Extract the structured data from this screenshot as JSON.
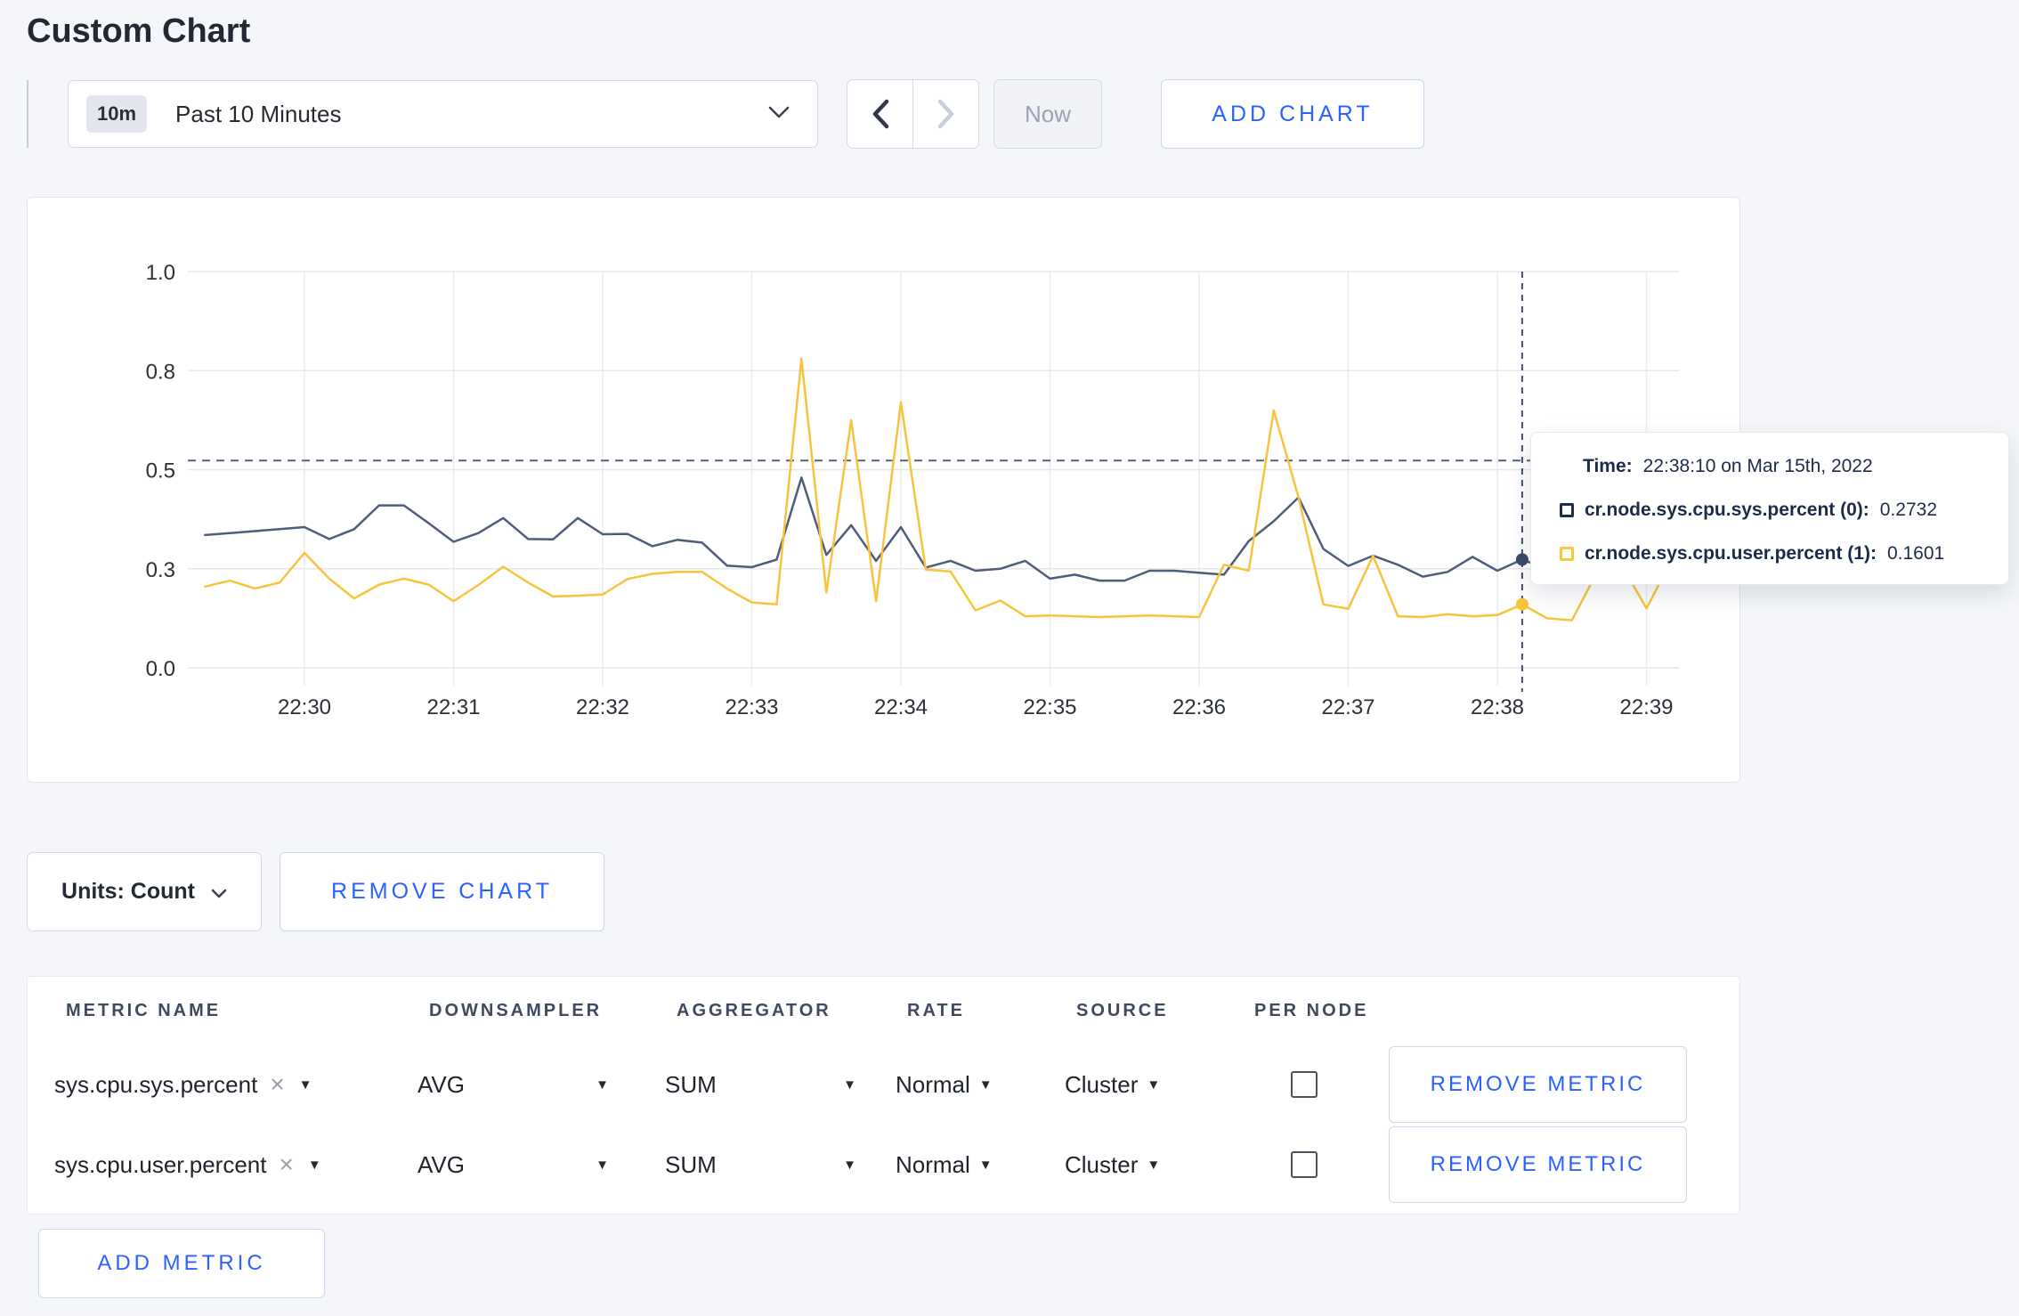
{
  "page": {
    "title": "Custom Chart",
    "accent_blue": "#2962ff",
    "background": "#f4f6f9"
  },
  "icons": {
    "clear_x": "×",
    "caret_down": "▼"
  },
  "toolbar": {
    "time_badge": "10m",
    "time_label": "Past 10 Minutes",
    "now_label": "Now",
    "add_chart_label": "ADD CHART"
  },
  "tooltip": {
    "time_label": "Time:",
    "time_value": "22:38:10 on Mar 15th, 2022",
    "series": [
      {
        "label": "cr.node.sys.cpu.sys.percent (0):",
        "value": "0.2732",
        "color": "#1b2d4f"
      },
      {
        "label": "cr.node.sys.cpu.user.percent (1):",
        "value": "0.1601",
        "color": "#ffc53d"
      }
    ]
  },
  "chart_data": {
    "type": "line",
    "title": "",
    "xlabel": "",
    "ylabel": "",
    "ylim": [
      0,
      1
    ],
    "grid": true,
    "legend_position": "tooltip",
    "yticks": [
      {
        "label": "0.0",
        "value": 0
      },
      {
        "label": "0.3",
        "value": 0.25
      },
      {
        "label": "0.5",
        "value": 0.5
      },
      {
        "label": "0.8",
        "value": 0.75
      },
      {
        "label": "1.0",
        "value": 1
      }
    ],
    "xticks": [
      "22:30",
      "22:31",
      "22:32",
      "22:33",
      "22:34",
      "22:35",
      "22:36",
      "22:37",
      "22:38",
      "22:39"
    ],
    "x_times": [
      "22:29:20",
      "22:29:30",
      "22:29:40",
      "22:29:50",
      "22:30:00",
      "22:30:10",
      "22:30:20",
      "22:30:30",
      "22:30:40",
      "22:30:50",
      "22:31:00",
      "22:31:10",
      "22:31:20",
      "22:31:30",
      "22:31:40",
      "22:31:50",
      "22:32:00",
      "22:32:10",
      "22:32:20",
      "22:32:30",
      "22:32:40",
      "22:32:50",
      "22:33:00",
      "22:33:10",
      "22:33:20",
      "22:33:30",
      "22:33:40",
      "22:33:50",
      "22:34:00",
      "22:34:10",
      "22:34:20",
      "22:34:30",
      "22:34:40",
      "22:34:50",
      "22:35:00",
      "22:35:10",
      "22:35:20",
      "22:35:30",
      "22:35:40",
      "22:35:50",
      "22:36:00",
      "22:36:10",
      "22:36:20",
      "22:36:30",
      "22:36:40",
      "22:36:50",
      "22:37:00",
      "22:37:10",
      "22:37:20",
      "22:37:30",
      "22:37:40",
      "22:37:50",
      "22:38:00",
      "22:38:10",
      "22:38:20",
      "22:38:30",
      "22:38:40",
      "22:38:50",
      "22:39:00",
      "22:39:10"
    ],
    "series": [
      {
        "name": "cr.node.sys.cpu.sys.percent",
        "color": "#4e5d7c",
        "values": [
          0.335,
          0.34,
          0.345,
          0.35,
          0.355,
          0.325,
          0.35,
          0.41,
          0.41,
          0.365,
          0.318,
          0.34,
          0.378,
          0.325,
          0.324,
          0.378,
          0.337,
          0.338,
          0.307,
          0.323,
          0.316,
          0.258,
          0.254,
          0.273,
          0.48,
          0.285,
          0.36,
          0.27,
          0.355,
          0.253,
          0.27,
          0.245,
          0.25,
          0.27,
          0.225,
          0.235,
          0.22,
          0.22,
          0.245,
          0.245,
          0.24,
          0.235,
          0.32,
          0.37,
          0.43,
          0.3,
          0.257,
          0.283,
          0.26,
          0.23,
          0.242,
          0.28,
          0.245,
          0.2732,
          0.25,
          0.26,
          0.27,
          0.285,
          0.3,
          0.295
        ]
      },
      {
        "name": "cr.node.sys.cpu.user.percent",
        "color": "#f8c43d",
        "values": [
          0.205,
          0.22,
          0.2,
          0.215,
          0.29,
          0.225,
          0.175,
          0.21,
          0.225,
          0.21,
          0.168,
          0.209,
          0.255,
          0.215,
          0.18,
          0.182,
          0.185,
          0.224,
          0.237,
          0.242,
          0.242,
          0.2,
          0.165,
          0.16,
          0.78,
          0.19,
          0.625,
          0.168,
          0.67,
          0.248,
          0.243,
          0.145,
          0.17,
          0.13,
          0.132,
          0.13,
          0.128,
          0.13,
          0.132,
          0.13,
          0.128,
          0.26,
          0.245,
          0.65,
          0.43,
          0.16,
          0.149,
          0.283,
          0.13,
          0.128,
          0.135,
          0.13,
          0.133,
          0.1601,
          0.125,
          0.12,
          0.24,
          0.26,
          0.15,
          0.27
        ]
      }
    ],
    "ref_line_value": 0.523,
    "crosshair": {
      "time": "22:38:10",
      "x_index": 53,
      "sys_value": 0.2732,
      "user_value": 0.1601
    }
  },
  "chart_footer": {
    "units_label": "Units: Count",
    "remove_chart_label": "REMOVE CHART"
  },
  "metrics_table": {
    "headers": [
      "METRIC NAME",
      "DOWNSAMPLER",
      "AGGREGATOR",
      "RATE",
      "SOURCE",
      "PER NODE"
    ],
    "rows": [
      {
        "metric": "sys.cpu.sys.percent",
        "downsampler": "AVG",
        "aggregator": "SUM",
        "rate": "Normal",
        "source": "Cluster",
        "per_node_checked": false,
        "remove_label": "REMOVE METRIC"
      },
      {
        "metric": "sys.cpu.user.percent",
        "downsampler": "AVG",
        "aggregator": "SUM",
        "rate": "Normal",
        "source": "Cluster",
        "per_node_checked": false,
        "remove_label": "REMOVE METRIC"
      }
    ],
    "add_metric_label": "ADD METRIC"
  }
}
